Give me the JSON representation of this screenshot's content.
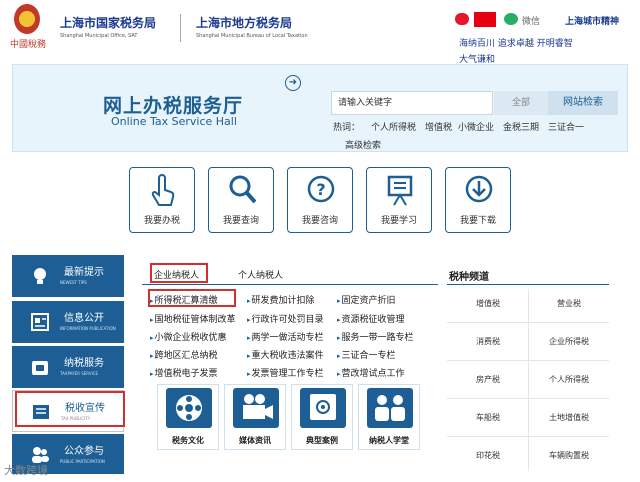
{
  "header": {
    "motto": "中國稅務",
    "state_tax_cn": "上海市国家税务局",
    "state_tax_en": "Shanghai Municipal Office, SAT",
    "local_tax_cn": "上海市地方税务局",
    "local_tax_en": "Shanghai Municipal Bureau of Local Taxation",
    "weixin_label": "微信",
    "city_spirit": "上海城市精神",
    "spirit_line1": "海纳百川  追求卓越  开明睿智",
    "spirit_line2": "大气谦和"
  },
  "banner": {
    "title_cn": "网上办税服务厅",
    "title_en": "Online Tax Service Hall",
    "search_placeholder": "请输入关键字",
    "scope_label": "全部",
    "search_button": "网站检索",
    "hot_label": "热词：",
    "hot_words": [
      "个人所得税",
      "增值税",
      "小微企业",
      "金税三期",
      "三证合一"
    ],
    "advanced_search": "高级检索"
  },
  "quick_actions": [
    {
      "label": "我要办税",
      "icon": "hand-pointer-icon"
    },
    {
      "label": "我要查询",
      "icon": "search-icon"
    },
    {
      "label": "我要咨询",
      "icon": "question-icon"
    },
    {
      "label": "我要学习",
      "icon": "presentation-icon"
    },
    {
      "label": "我要下载",
      "icon": "download-icon"
    }
  ],
  "sidebar": [
    {
      "cn": "最新提示",
      "en": "NEWEST TIPS",
      "icon": "lightbulb-icon"
    },
    {
      "cn": "信息公开",
      "en": "INFORMATION PUBLICATION",
      "icon": "document-icon"
    },
    {
      "cn": "纳税服务",
      "en": "TAXPAYER SERVICE",
      "icon": "service-icon"
    },
    {
      "cn": "税收宣传",
      "en": "TAX PUBLICITY",
      "icon": "publicity-icon"
    },
    {
      "cn": "公众参与",
      "en": "PUBLIC PARTICIPATION",
      "icon": "people-icon"
    }
  ],
  "tabs": {
    "enterprise": "企业纳税人",
    "individual": "个人纳税人"
  },
  "enterprise_links": [
    [
      "所得税汇算清缴",
      "研发费加计扣除",
      "固定资产折旧"
    ],
    [
      "国地税征管体制改革",
      "行政许可处罚目录",
      "资源税征收管理"
    ],
    [
      "小微企业税收优惠",
      "两学一做活动专栏",
      "服务一带一路专栏"
    ],
    [
      "跨地区汇总纳税",
      "重大税收违法案件",
      "三证合一专栏"
    ],
    [
      "增值税电子发票",
      "发票管理工作专栏",
      "营改增试点工作"
    ]
  ],
  "feature_tiles": [
    {
      "label": "税务文化",
      "icon": "film-reel-icon"
    },
    {
      "label": "媒体资讯",
      "icon": "video-camera-icon"
    },
    {
      "label": "典型案例",
      "icon": "safe-icon"
    },
    {
      "label": "纳税人学堂",
      "icon": "students-icon"
    }
  ],
  "tax_channel": {
    "title": "税种频道",
    "items": [
      "增值税",
      "营业税",
      "消费税",
      "企业所得税",
      "房产税",
      "个人所得税",
      "车船税",
      "土地增值税",
      "印花税",
      "车辆购置税"
    ]
  },
  "watermark": "大数跨境"
}
